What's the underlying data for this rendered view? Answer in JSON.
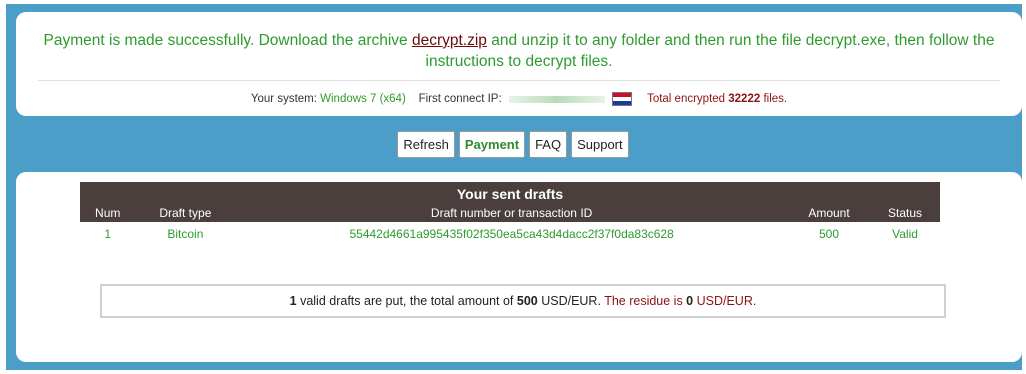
{
  "message": {
    "part1": "Payment is made successfully. Download the archive ",
    "link": "decrypt.zip",
    "part2": " and unzip it to any folder and then run the file decrypt.exe, then follow the instructions to decrypt files."
  },
  "system": {
    "label": "Your system:",
    "value": "Windows 7 (x64)",
    "ip_label": "First connect IP:",
    "total_label": "Total encrypted",
    "total_value": "32222",
    "total_suffix": "files."
  },
  "nav": [
    "Refresh",
    "Payment",
    "FAQ",
    "Support"
  ],
  "drafts": {
    "title": "Your sent drafts",
    "columns": [
      "Num",
      "Draft type",
      "Draft number or transaction ID",
      "Amount",
      "Status"
    ],
    "rows": [
      [
        "1",
        "Bitcoin",
        "55442d4661a995435f02f350ea5ca43d4dacc2f37f0da83c628",
        "500",
        "Valid"
      ]
    ]
  },
  "summary": {
    "count": "1",
    "t1": " valid drafts are put, the total amount of ",
    "amount": "500",
    "t2": " USD/EUR. ",
    "residue_label": "The residue is ",
    "residue": "0",
    "t3": " USD/EUR."
  },
  "colors": {
    "frame": "#4a9ec8",
    "accent_green": "#2e9b2e",
    "header_dark": "#4a3f3c",
    "accent_red": "#8a1414"
  }
}
